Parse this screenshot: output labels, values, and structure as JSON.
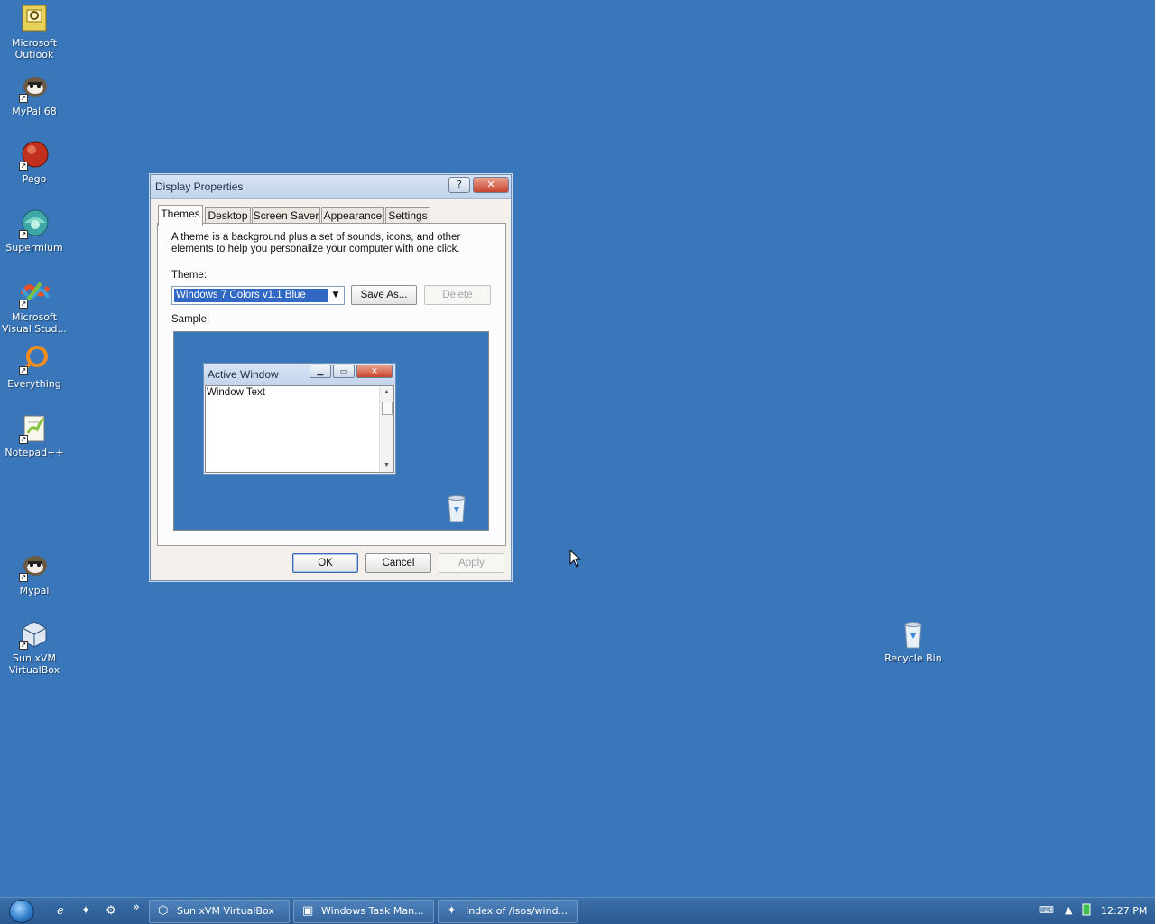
{
  "desktop": {
    "icons": [
      {
        "label_line1": "Microsoft",
        "label_line2": "Outlook",
        "icon": "outlook-icon"
      },
      {
        "label_line1": "MyPal 68",
        "label_line2": "",
        "icon": "mypal-icon"
      },
      {
        "label_line1": "Pego",
        "label_line2": "",
        "icon": "pego-icon"
      },
      {
        "label_line1": "Supermium",
        "label_line2": "",
        "icon": "supermium-icon"
      },
      {
        "label_line1": "Microsoft",
        "label_line2": "Visual Stud...",
        "icon": "visual-studio-icon"
      },
      {
        "label_line1": "Everything",
        "label_line2": "",
        "icon": "everything-icon"
      },
      {
        "label_line1": "Notepad++",
        "label_line2": "",
        "icon": "notepadpp-icon"
      },
      {
        "label_line1": "Mypal",
        "label_line2": "",
        "icon": "mypal-icon"
      },
      {
        "label_line1": "Sun xVM",
        "label_line2": "VirtualBox",
        "icon": "virtualbox-icon"
      }
    ],
    "recycle_bin": "Recycle Bin"
  },
  "dialog": {
    "title": "Display Properties",
    "help_glyph": "?",
    "close_glyph": "✕",
    "tabs": [
      "Themes",
      "Desktop",
      "Screen Saver",
      "Appearance",
      "Settings"
    ],
    "active_tab": "Themes",
    "description": "A theme is a background plus a set of sounds, icons, and other elements to help you personalize your computer with one click.",
    "theme_label": "Theme:",
    "theme_value": "Windows 7 Colors v1.1 Blue",
    "save_as": "Save As...",
    "delete": "Delete",
    "sample_label": "Sample:",
    "sample": {
      "active_window_title": "Active Window",
      "window_text": "Window Text"
    },
    "ok": "OK",
    "cancel": "Cancel",
    "apply": "Apply"
  },
  "taskbar": {
    "quick_launch_more": "»",
    "buttons": [
      {
        "label": "Sun xVM VirtualBox",
        "icon": "virtualbox-icon"
      },
      {
        "label": "Windows Task Man...",
        "icon": "task-manager-icon"
      },
      {
        "label": "Index of /isos/wind...",
        "icon": "mypal-icon"
      }
    ],
    "clock": "12:27 PM"
  },
  "colors": {
    "desktop_bg": "#3a77ba",
    "selection": "#3168c4",
    "close_button": "#c8452c"
  }
}
